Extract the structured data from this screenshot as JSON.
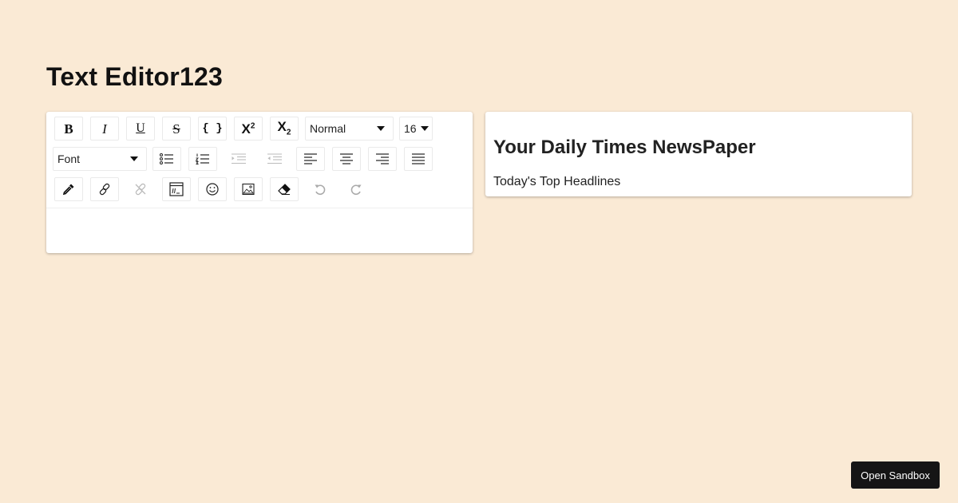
{
  "page": {
    "title": "Text Editor123",
    "background_color": "#faead5"
  },
  "toolbar": {
    "row1": [
      {
        "name": "bold",
        "icon": "bold-icon",
        "label": "B"
      },
      {
        "name": "italic",
        "icon": "italic-icon",
        "label": "I"
      },
      {
        "name": "underline",
        "icon": "underline-icon",
        "label": "U"
      },
      {
        "name": "strikethrough",
        "icon": "strikethrough-icon",
        "label": "S"
      },
      {
        "name": "code",
        "icon": "code-icon",
        "label": "{ }"
      },
      {
        "name": "superscript",
        "icon": "superscript-icon",
        "label": "X",
        "script": "2"
      },
      {
        "name": "subscript",
        "icon": "subscript-icon",
        "label": "X",
        "script": "2"
      }
    ],
    "block_type": {
      "selected": "Normal"
    },
    "font_size": {
      "selected": "16"
    },
    "font_family": {
      "selected": "Font"
    },
    "row2": [
      {
        "name": "unordered-list",
        "icon": "unordered-list-icon"
      },
      {
        "name": "ordered-list",
        "icon": "ordered-list-icon"
      },
      {
        "name": "indent",
        "icon": "indent-icon",
        "disabled": true
      },
      {
        "name": "outdent",
        "icon": "outdent-icon",
        "disabled": true
      },
      {
        "name": "align-left",
        "icon": "align-left-icon"
      },
      {
        "name": "align-center",
        "icon": "align-center-icon"
      },
      {
        "name": "align-right",
        "icon": "align-right-icon"
      },
      {
        "name": "align-justify",
        "icon": "align-justify-icon"
      }
    ],
    "row3": [
      {
        "name": "color-picker",
        "icon": "eyedropper-icon"
      },
      {
        "name": "link",
        "icon": "link-icon"
      },
      {
        "name": "unlink",
        "icon": "unlink-icon",
        "disabled": true
      },
      {
        "name": "embedded",
        "icon": "embed-icon"
      },
      {
        "name": "emoji",
        "icon": "emoji-icon"
      },
      {
        "name": "image",
        "icon": "image-icon"
      },
      {
        "name": "remove-format",
        "icon": "eraser-icon"
      },
      {
        "name": "undo",
        "icon": "undo-icon",
        "disabled": true
      },
      {
        "name": "redo",
        "icon": "redo-icon",
        "disabled": true
      }
    ]
  },
  "editor": {
    "content": ""
  },
  "preview": {
    "heading": "Your Daily Times NewsPaper",
    "paragraph": "Today's Top Headlines"
  },
  "sandbox_button": {
    "label": "Open Sandbox"
  }
}
